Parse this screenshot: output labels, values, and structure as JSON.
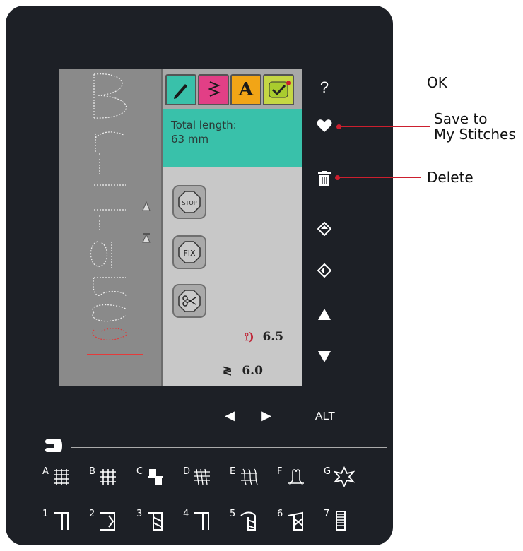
{
  "screen": {
    "tabs": [
      "edit-tab",
      "stitch-tab",
      "font-tab",
      "ok-tab"
    ],
    "font_tab_label": "A",
    "info": {
      "line1": "Total length:",
      "line2": "63 mm"
    },
    "buttons": {
      "stop": "STOP",
      "fix": "FIX"
    },
    "stitch_length": "6.5",
    "stitch_width": "6.0",
    "stitch_text": "Brilliance"
  },
  "right_bar": {
    "help": "?",
    "icons": [
      "help-icon",
      "heart-icon",
      "trash-icon",
      "diamond-up-icon",
      "diamond-left-icon",
      "triangle-up-icon",
      "triangle-down-icon"
    ]
  },
  "nav": {
    "left": "◀",
    "right": "▶",
    "alt": "ALT"
  },
  "callouts": {
    "ok": "OK",
    "save_1": "Save to",
    "save_2": "My Stitches",
    "delete": "Delete"
  },
  "categories": [
    "A",
    "B",
    "C",
    "D",
    "E",
    "F",
    "G"
  ],
  "numbers": [
    "1",
    "2",
    "3",
    "4",
    "5",
    "6",
    "7"
  ],
  "colors": {
    "panel": "#1d2026",
    "accent": "#39c1aa",
    "callout": "#cc1f2e"
  }
}
